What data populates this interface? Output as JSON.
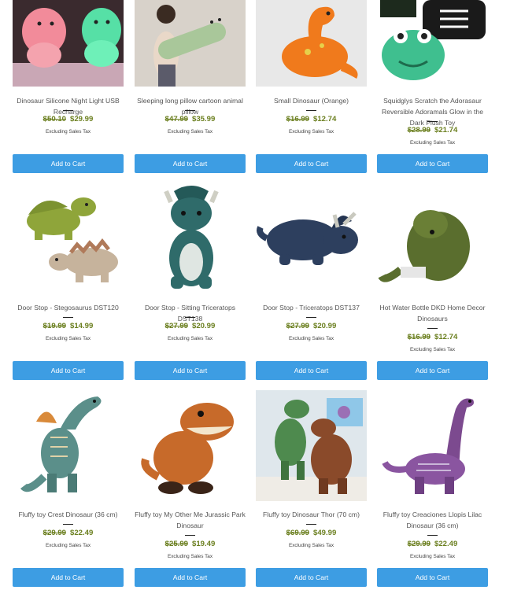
{
  "products": [
    {
      "title": "Dinosaur Silicone Night Light USB Recharge",
      "old_price": "$50.10",
      "price": "$29.99",
      "tax_note": "Excluding Sales Tax",
      "button": "Add to Cart",
      "image": "dino-night-light-image"
    },
    {
      "title": "Sleeping long pillow cartoon animal pillow",
      "old_price": "$47.99",
      "price": "$35.99",
      "tax_note": "Excluding Sales Tax",
      "button": "Add to Cart",
      "image": "long-pillow-image"
    },
    {
      "title": "Small Dinosaur (Orange)",
      "old_price": "$16.99",
      "price": "$12.74",
      "tax_note": "Excluding Sales Tax",
      "button": "Add to Cart",
      "image": "orange-dinosaur-image"
    },
    {
      "title": "Squidglys Scratch the Adorasaur Reversible Adoramals Glow in the Dark Plush Toy",
      "old_price": "$28.99",
      "price": "$21.74",
      "tax_note": "Excluding Sales Tax",
      "button": "Add to Cart",
      "image": "reversible-plush-image"
    },
    {
      "title": "Door Stop - Stegosaurus DST120",
      "old_price": "$19.99",
      "price": "$14.99",
      "tax_note": "Excluding Sales Tax",
      "button": "Add to Cart",
      "image": "stegosaurus-doorstop-image"
    },
    {
      "title": "Door Stop - Sitting Triceratops DST138",
      "old_price": "$27.99",
      "price": "$20.99",
      "tax_note": "Excluding Sales Tax",
      "button": "Add to Cart",
      "image": "sitting-triceratops-image"
    },
    {
      "title": "Door Stop - Triceratops DST137",
      "old_price": "$27.99",
      "price": "$20.99",
      "tax_note": "Excluding Sales Tax",
      "button": "Add to Cart",
      "image": "triceratops-doorstop-image"
    },
    {
      "title": "Hot Water Bottle DKD Home Decor Dinosaurs",
      "old_price": "$16.99",
      "price": "$12.74",
      "tax_note": "Excluding Sales Tax",
      "button": "Add to Cart",
      "image": "hot-water-bottle-image"
    },
    {
      "title": "Fluffy toy Crest Dinosaur (36 cm)",
      "old_price": "$29.99",
      "price": "$22.49",
      "tax_note": "Excluding Sales Tax",
      "button": "Add to Cart",
      "image": "crest-dinosaur-image"
    },
    {
      "title": "Fluffy toy My Other Me Jurassic Park Dinosaur",
      "old_price": "$25.99",
      "price": "$19.49",
      "tax_note": "Excluding Sales Tax",
      "button": "Add to Cart",
      "image": "jurassic-park-dinosaur-image"
    },
    {
      "title": "Fluffy toy Dinosaur Thor (70 cm)",
      "old_price": "$69.99",
      "price": "$49.99",
      "tax_note": "Excluding Sales Tax",
      "button": "Add to Cart",
      "image": "dinosaur-thor-image"
    },
    {
      "title": "Fluffy toy Creaciones Llopis Lilac Dinosaur (36 cm)",
      "old_price": "$29.99",
      "price": "$22.49",
      "tax_note": "Excluding Sales Tax",
      "button": "Add to Cart",
      "image": "lilac-dinosaur-image"
    }
  ],
  "colors": {
    "price": "#6b7f1f",
    "button": "#3d9de3",
    "title": "#555555"
  }
}
